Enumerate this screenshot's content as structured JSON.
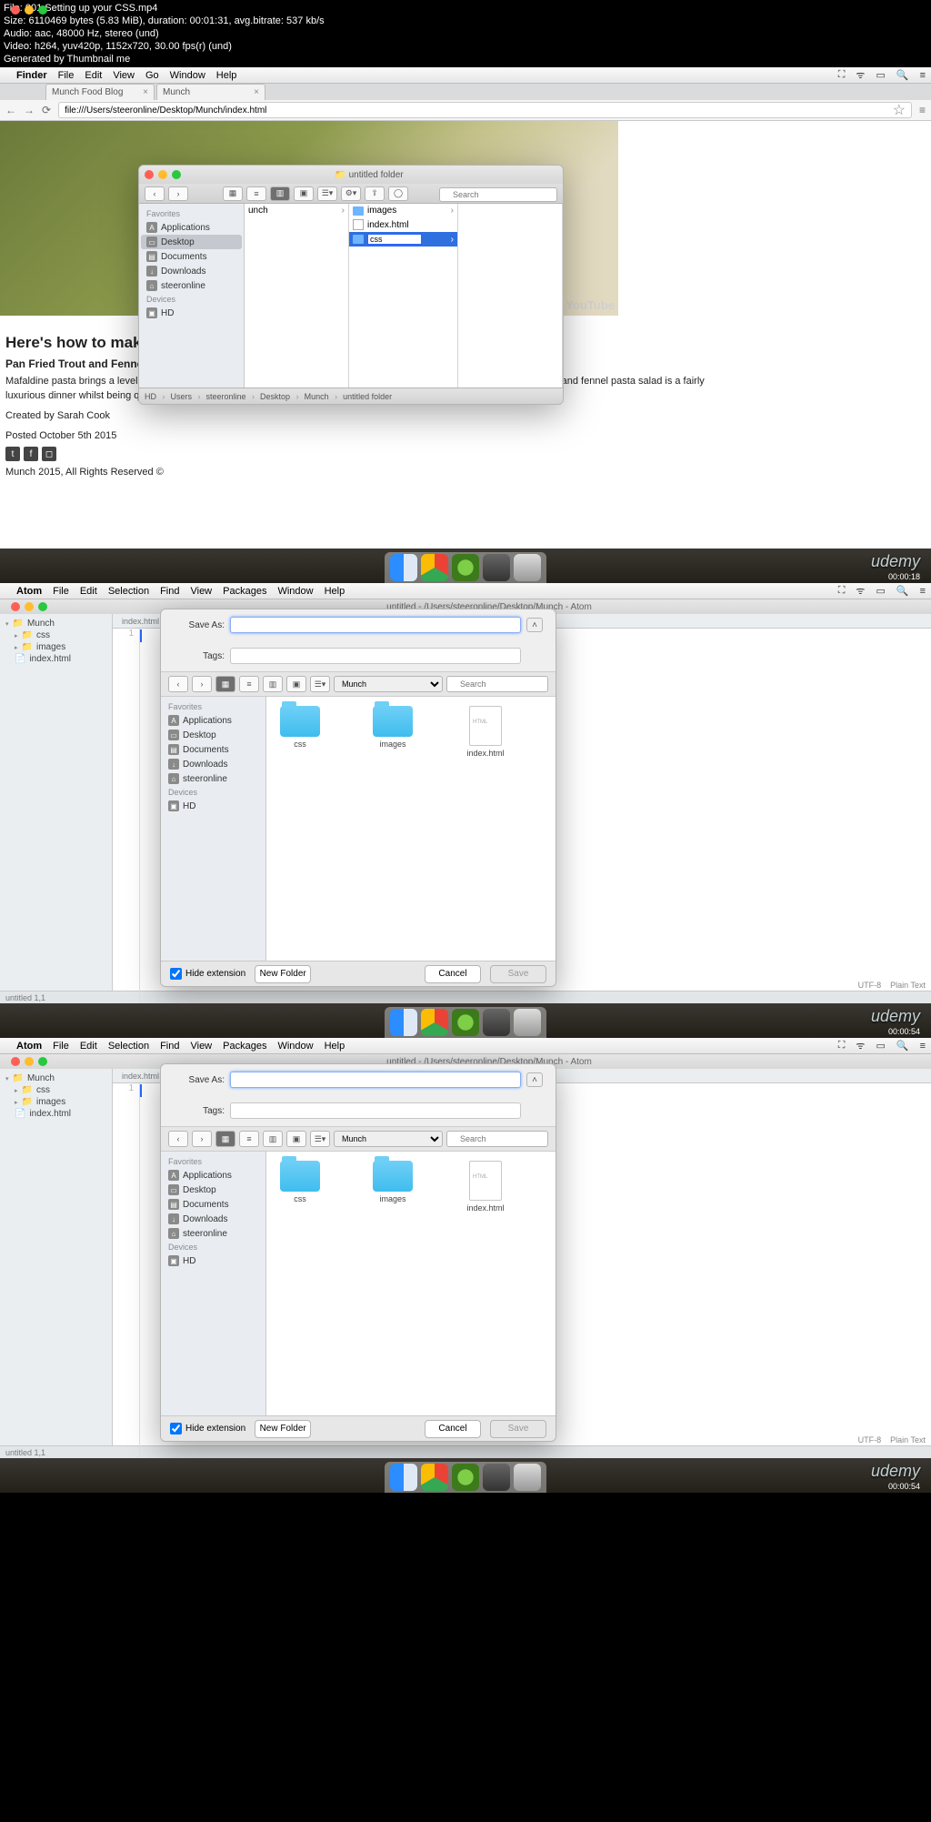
{
  "ffmpeg": {
    "l1": "File: 001 Setting up your CSS.mp4",
    "l2": "Size: 6110469 bytes (5.83 MiB), duration: 00:01:31, avg.bitrate: 537 kb/s",
    "l3": "Audio: aac, 48000 Hz, stereo (und)",
    "l4": "Video: h264, yuv420p, 1152x720, 30.00 fps(r) (und)",
    "l5": "Generated by Thumbnail me"
  },
  "finder_menubar": {
    "app": "Finder",
    "items": [
      "File",
      "Edit",
      "View",
      "Go",
      "Window",
      "Help"
    ],
    "apple": ""
  },
  "atom_menubar": {
    "app": "Atom",
    "items": [
      "File",
      "Edit",
      "Selection",
      "Find",
      "View",
      "Packages",
      "Window",
      "Help"
    ],
    "apple": ""
  },
  "browser": {
    "tabs": [
      {
        "label": "Munch Food Blog"
      },
      {
        "label": "Munch"
      }
    ],
    "url": "file:///Users/steeronline/Desktop/Munch/index.html",
    "star": "☆",
    "hamburger": "≡"
  },
  "webpage": {
    "h2": "Here's how to make the",
    "h3": "Pan Fried Trout and Fennel F",
    "p1": "Mafaldine pasta brings a level of dec",
    "p1b": "and fennel pasta salad is a fairly",
    "p2": "luxurious dinner whilst being quick a",
    "by": "Created by Sarah Cook",
    "date": "Posted October 5th 2015",
    "foot": "Munch 2015, All Rights Reserved ©",
    "yt": "YouTube"
  },
  "finder": {
    "title": "untitled folder",
    "search_ph": "Search",
    "favorites": "Favorites",
    "devices": "Devices",
    "sidebar": [
      "Applications",
      "Desktop",
      "Documents",
      "Downloads",
      "steeronline"
    ],
    "hd": "HD",
    "col1": "unch",
    "items": {
      "images": "images",
      "index": "index.html",
      "css": "css"
    },
    "path": [
      "HD",
      "Users",
      "steeronline",
      "Desktop",
      "Munch",
      "untitled folder"
    ]
  },
  "atom": {
    "title": "untitled - /Users/steeronline/Desktop/Munch - Atom",
    "tree": {
      "root": "Munch",
      "css": "css",
      "images": "images",
      "index": "index.html"
    },
    "tab": "index.html",
    "line": "1",
    "status_left": "untitled   1,1",
    "enc": "UTF-8",
    "lang": "Plain Text"
  },
  "save": {
    "save_as": "Save As:",
    "tags": "Tags:",
    "loc": "Munch",
    "search_ph": "Search",
    "favorites": "Favorites",
    "devices": "Devices",
    "sidebar": [
      "Applications",
      "Desktop",
      "Documents",
      "Downloads",
      "steeronline"
    ],
    "hd": "HD",
    "items": {
      "css": "css",
      "images": "images",
      "index": "index.html"
    },
    "hide": "Hide extension",
    "new_folder": "New Folder",
    "cancel": "Cancel",
    "save": "Save"
  },
  "timestamps": {
    "t1": "00:00:18",
    "t2": "00:00:54",
    "t3": "00:00:54"
  },
  "udemy": "udemy"
}
